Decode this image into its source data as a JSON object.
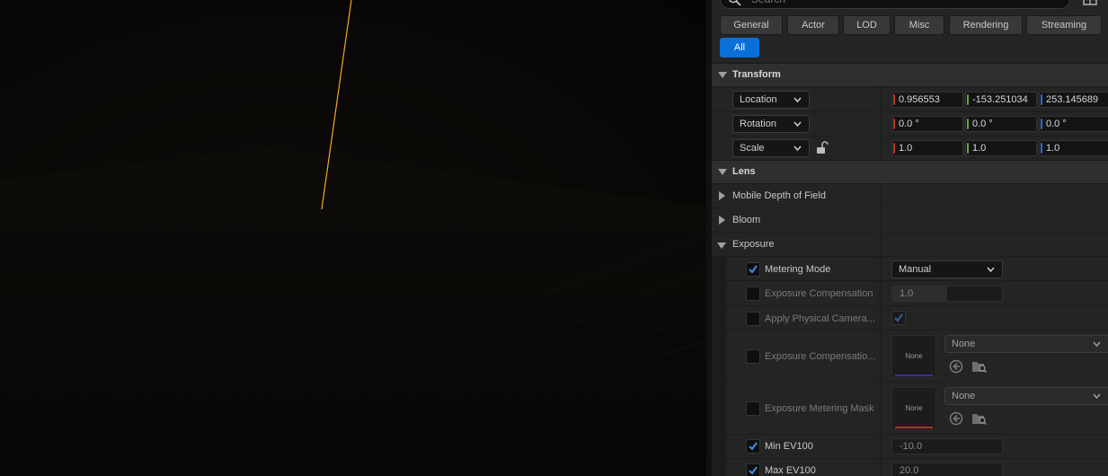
{
  "search": {
    "placeholder": "Search"
  },
  "filters": {
    "row1": [
      "General",
      "Actor",
      "LOD",
      "Misc",
      "Rendering",
      "Streaming"
    ],
    "row2": [
      "All"
    ],
    "active": "All"
  },
  "transform": {
    "title": "Transform",
    "location": {
      "label": "Location",
      "x": "0.956553",
      "y": "-153.251034",
      "z": "253.145689"
    },
    "rotation": {
      "label": "Rotation",
      "x": "0.0 °",
      "y": "0.0 °",
      "z": "0.0 °"
    },
    "scale": {
      "label": "Scale",
      "x": "1.0",
      "y": "1.0",
      "z": "1.0"
    }
  },
  "lens": {
    "title": "Lens",
    "groups": {
      "mobile_dof": "Mobile Depth of Field",
      "bloom": "Bloom",
      "exposure": "Exposure"
    },
    "exposure": {
      "metering_mode": {
        "label": "Metering Mode",
        "value": "Manual",
        "enabled": true
      },
      "exposure_compensation": {
        "label": "Exposure Compensation",
        "value": "1.0",
        "fill": 0.5,
        "enabled": false
      },
      "apply_physical_camera": {
        "label": "Apply Physical Camera...",
        "checked": true,
        "enabled": false
      },
      "exposure_compensation_curve": {
        "label": "Exposure Compensatio...",
        "thumb": "None",
        "asset": "None",
        "enabled": false
      },
      "exposure_metering_mask": {
        "label": "Exposure Metering Mask",
        "thumb": "None",
        "asset": "None",
        "enabled": false
      },
      "min_ev100": {
        "label": "Min EV100",
        "value": "-10.0",
        "enabled": true
      },
      "max_ev100": {
        "label": "Max EV100",
        "value": "20.0",
        "enabled": true
      }
    }
  },
  "colors": {
    "accent": "#0a70d8",
    "axis_x": "#c13a2a",
    "axis_y": "#6aa82a",
    "axis_z": "#2a6fd6",
    "viewport_line": "#f5a623",
    "curve_thumb_bar": "#3b2f9a",
    "mask_thumb_bar": "#b0302a"
  }
}
